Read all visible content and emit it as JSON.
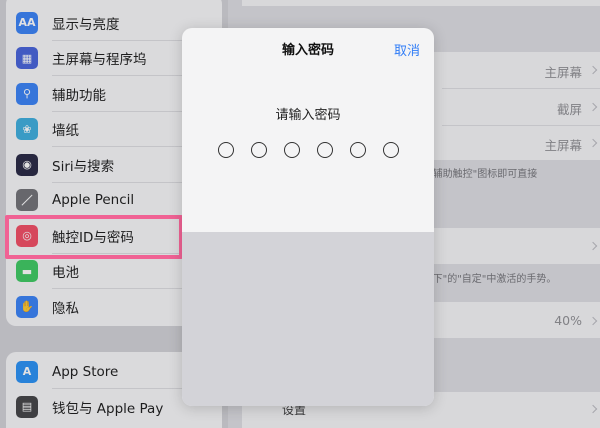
{
  "sidebar": {
    "group1": [
      {
        "label": "显示与亮度",
        "icon": "display-brightness-icon",
        "icon_text": "AA",
        "color": "#2f7cf6"
      },
      {
        "label": "主屏幕与程序坞",
        "icon": "home-screen-icon",
        "icon_text": "▦",
        "color": "#3d5bd8"
      },
      {
        "label": "辅助功能",
        "icon": "accessibility-icon",
        "icon_text": "⚲",
        "color": "#2f7cf6"
      },
      {
        "label": "墙纸",
        "icon": "wallpaper-icon",
        "icon_text": "❀",
        "color": "#34aadc"
      },
      {
        "label": "Siri与搜索",
        "icon": "siri-icon",
        "icon_text": "◉",
        "color": "#1d1d3a"
      },
      {
        "label": "Apple Pencil",
        "icon": "pencil-icon",
        "icon_text": "／",
        "color": "#6b6b70"
      },
      {
        "label": "触控ID与密码",
        "icon": "fingerprint-icon",
        "icon_text": "◎",
        "color": "#f2445c"
      },
      {
        "label": "电池",
        "icon": "battery-icon",
        "icon_text": "▬",
        "color": "#34c759"
      },
      {
        "label": "隐私",
        "icon": "privacy-hand-icon",
        "icon_text": "✋",
        "color": "#2f7cf6"
      }
    ],
    "group2": [
      {
        "label": "App Store",
        "icon": "app-store-icon",
        "icon_text": "A",
        "color": "#1e8cf5"
      },
      {
        "label": "钱包与 Apple Pay",
        "icon": "wallet-icon",
        "icon_text": "▤",
        "color": "#3a3a3c"
      }
    ]
  },
  "detail": {
    "row1_value": "主屏幕",
    "row2_value": "截屏",
    "row3_value": "主屏幕",
    "note1": "\"辅助触控\"图标即可直接",
    "note2": "\"下\"的\"自定\"中激活的手势。",
    "row5_value": "40%",
    "bottom_label": "设置"
  },
  "modal": {
    "title": "输入密码",
    "cancel": "取消",
    "prompt": "请输入密码",
    "passcode_length": 6,
    "entered_digits": 0
  },
  "colors": {
    "accent": "#2f7cf6",
    "highlight": "#f06294"
  }
}
